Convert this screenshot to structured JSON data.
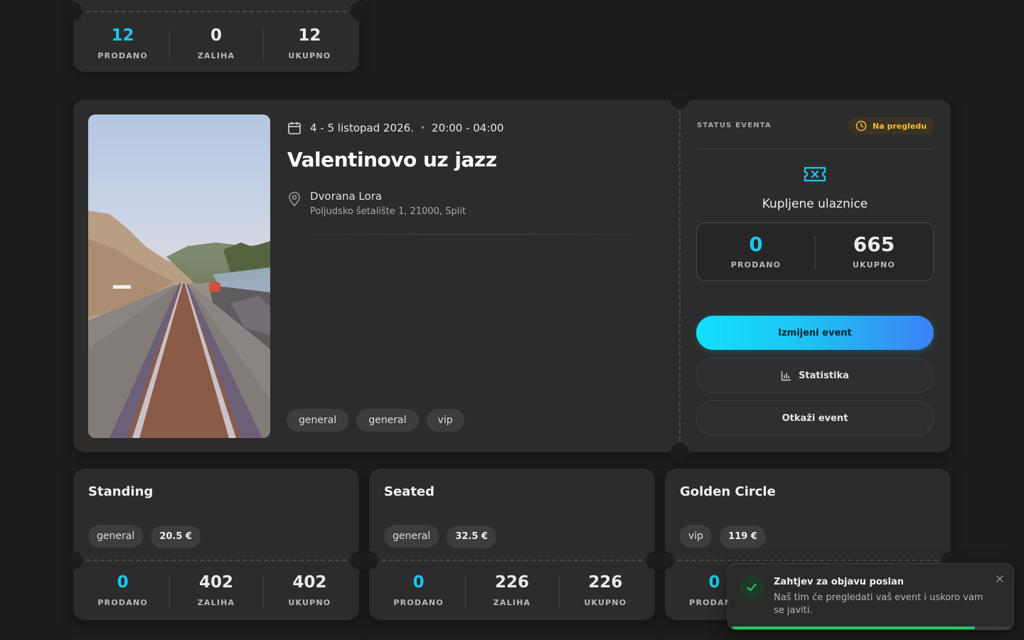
{
  "top_card": {
    "stats": [
      {
        "value": "12",
        "label": "PRODANO"
      },
      {
        "value": "0",
        "label": "ZALIHA"
      },
      {
        "value": "12",
        "label": "UKUPNO"
      }
    ]
  },
  "event": {
    "date": "4 - 5 listopad 2026.",
    "separator": "•",
    "time": "20:00 - 04:00",
    "title": "Valentinovo uz jazz",
    "venue_name": "Dvorana Lora",
    "venue_address": "Poljudsko šetalište 1, 21000, Split",
    "tags": [
      "general",
      "general",
      "vip"
    ],
    "image_icon": "event-photo-railway"
  },
  "status_panel": {
    "heading": "STATUS EVENTA",
    "status_badge": "Na pregledu",
    "status_icon": "clock-icon",
    "tickets_icon": "ticket-icon",
    "tickets_title": "Kupljene ulaznice",
    "stats": [
      {
        "value": "0",
        "label": "PRODANO"
      },
      {
        "value": "665",
        "label": "UKUPNO"
      }
    ],
    "edit_button": "Izmijeni event",
    "stats_button": "Statistika",
    "cancel_button": "Otkaži event"
  },
  "tiers": [
    {
      "title": "Standing",
      "tag": "general",
      "price": "20.5 €",
      "stats": [
        {
          "value": "0",
          "label": "PRODANO"
        },
        {
          "value": "402",
          "label": "ZALIHA"
        },
        {
          "value": "402",
          "label": "UKUPNO"
        }
      ]
    },
    {
      "title": "Seated",
      "tag": "general",
      "price": "32.5 €",
      "stats": [
        {
          "value": "0",
          "label": "PRODANO"
        },
        {
          "value": "226",
          "label": "ZALIHA"
        },
        {
          "value": "226",
          "label": "UKUPNO"
        }
      ]
    },
    {
      "title": "Golden Circle",
      "tag": "vip",
      "price": "119 €",
      "stats": [
        {
          "value": "0",
          "label": "PRODANO"
        }
      ]
    }
  ],
  "toast": {
    "title": "Zahtjev za objavu poslan",
    "message": "Naš tim će pregledati vaš event i uskoro vam se javiti.",
    "icon": "check-icon",
    "close_icon": "close-icon",
    "progress": 0.85
  },
  "colors": {
    "accent": "#19c9ef",
    "accent_gradient_end": "#3b82f6",
    "warning": "#f6b93b",
    "success": "#22c55e",
    "background": "#1d1d1d",
    "card": "#2c2c2c"
  }
}
